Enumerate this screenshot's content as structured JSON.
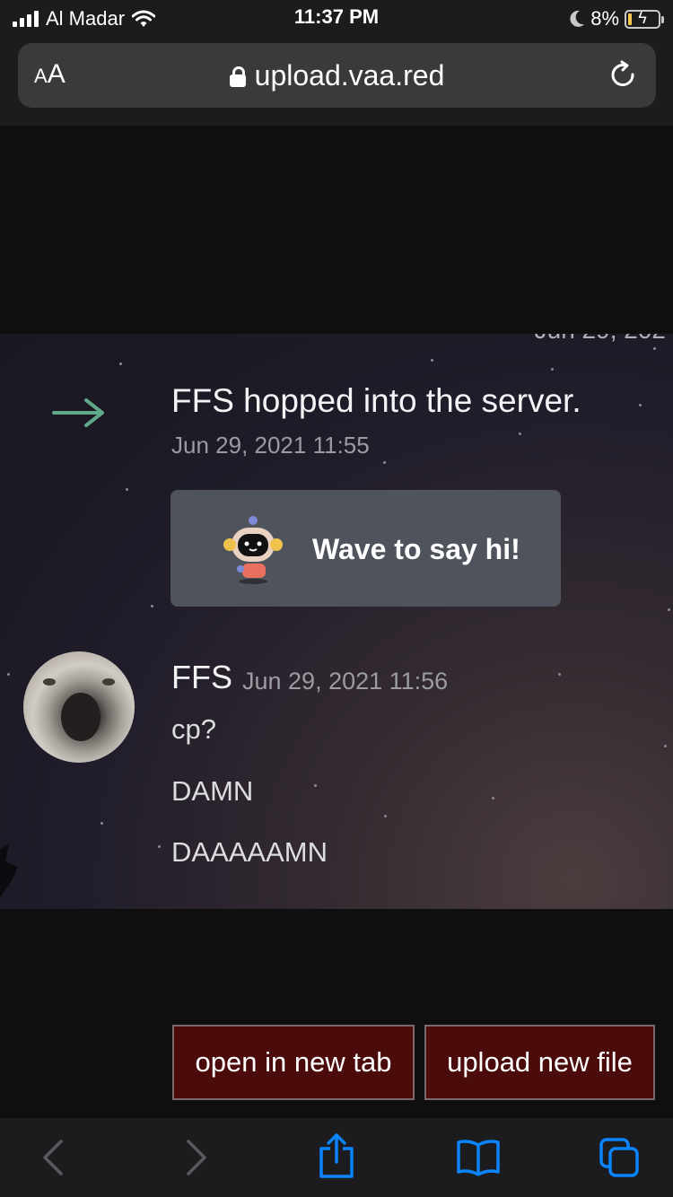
{
  "status_bar": {
    "carrier": "Al Madar",
    "time": "11:37 PM",
    "battery": "8%",
    "icons": [
      "signal-bars-icon",
      "wifi-icon",
      "moon-icon",
      "battery-charging-icon"
    ]
  },
  "browser": {
    "text_size_label": "AA",
    "url": "upload.vaa.red",
    "icons": [
      "lock-icon",
      "reload-icon"
    ]
  },
  "screenshot": {
    "top_date_fragment": "Jun 29, 202",
    "join_message": "FFS hopped into the server.",
    "join_timestamp": "Jun 29, 2021 11:55",
    "wave_button_label": "Wave to say hi!",
    "author": "FFS",
    "message_timestamp": "Jun 29, 2021 11:56",
    "messages": [
      "cp?",
      "DAMN",
      "DAAAAAMN"
    ],
    "accent_green": "#5fa88a",
    "button_color": "#4f545c"
  },
  "actions": {
    "open_new_tab": "open in new tab",
    "upload_new_file": "upload new file",
    "button_bg": "#4b0b0b"
  },
  "toolbar": {
    "items": [
      "back-icon",
      "forward-icon",
      "share-icon",
      "bookmarks-icon",
      "tabs-icon"
    ],
    "accent": "#0a84ff"
  }
}
